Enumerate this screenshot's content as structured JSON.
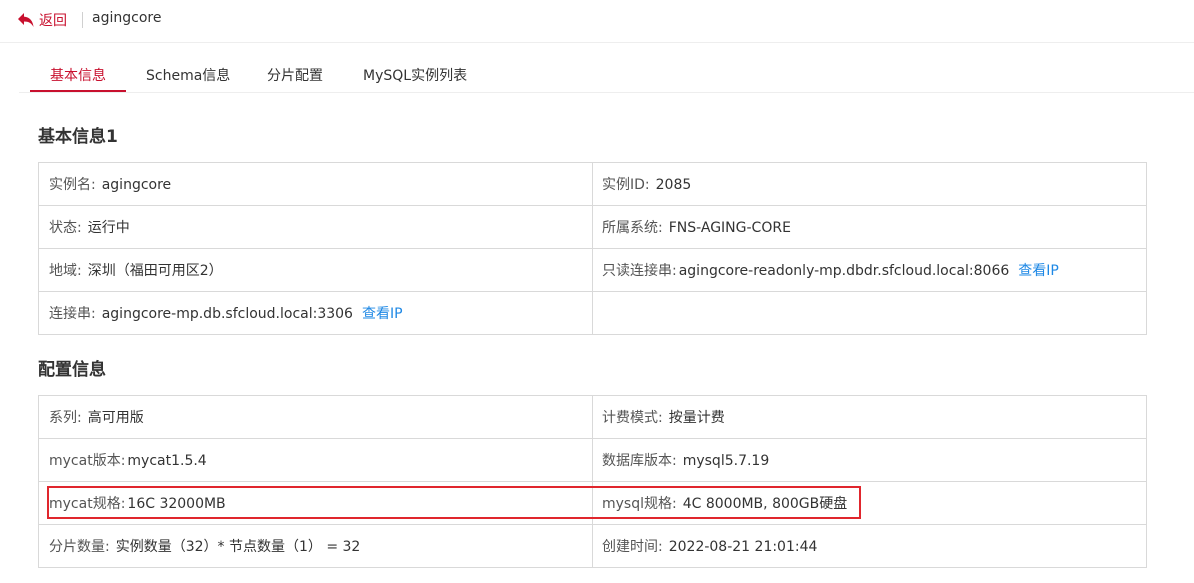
{
  "header": {
    "back_label": "返回",
    "instance_name": "agingcore"
  },
  "tabs": [
    {
      "label": "基本信息",
      "active": true
    },
    {
      "label": "Schema信息",
      "active": false
    },
    {
      "label": "分片配置",
      "active": false
    },
    {
      "label": "MySQL实例列表",
      "active": false
    }
  ],
  "basic": {
    "title": "基本信息1",
    "instance_name_label": "实例名:",
    "instance_name_value": "agingcore",
    "instance_id_label": "实例ID:",
    "instance_id_value": "2085",
    "status_label": "状态:",
    "status_value": "运行中",
    "system_label": "所属系统:",
    "system_value": "FNS-AGING-CORE",
    "region_label": "地域:",
    "region_value": "深圳（福田可用区2）",
    "readonly_conn_label": "只读连接串:",
    "readonly_conn_value": "agingcore-readonly-mp.dbdr.sfcloud.local:8066",
    "conn_label": "连接串:",
    "conn_value": "agingcore-mp.db.sfcloud.local:3306",
    "view_ip_label": "查看IP"
  },
  "config": {
    "title": "配置信息",
    "series_label": "系列:",
    "series_value": "高可用版",
    "billing_label": "计费模式:",
    "billing_value": "按量计费",
    "mycat_version_label": "mycat版本:",
    "mycat_version_value": "mycat1.5.4",
    "db_version_label": "数据库版本:",
    "db_version_value": "mysql5.7.19",
    "mycat_spec_label": "mycat规格:",
    "mycat_spec_value": "16C 32000MB",
    "mysql_spec_label": "mysql规格:",
    "mysql_spec_value": "4C 8000MB, 800GB硬盘",
    "shard_count_label": "分片数量:",
    "shard_count_value": "实例数量（32）* 节点数量（1） = 32",
    "created_label": "创建时间:",
    "created_value": "2022-08-21 21:01:44"
  },
  "colors": {
    "brand": "#c8102e",
    "link": "#1e88e5",
    "highlight": "#e0262d"
  },
  "icons": {
    "back": "back-arrow-icon"
  }
}
